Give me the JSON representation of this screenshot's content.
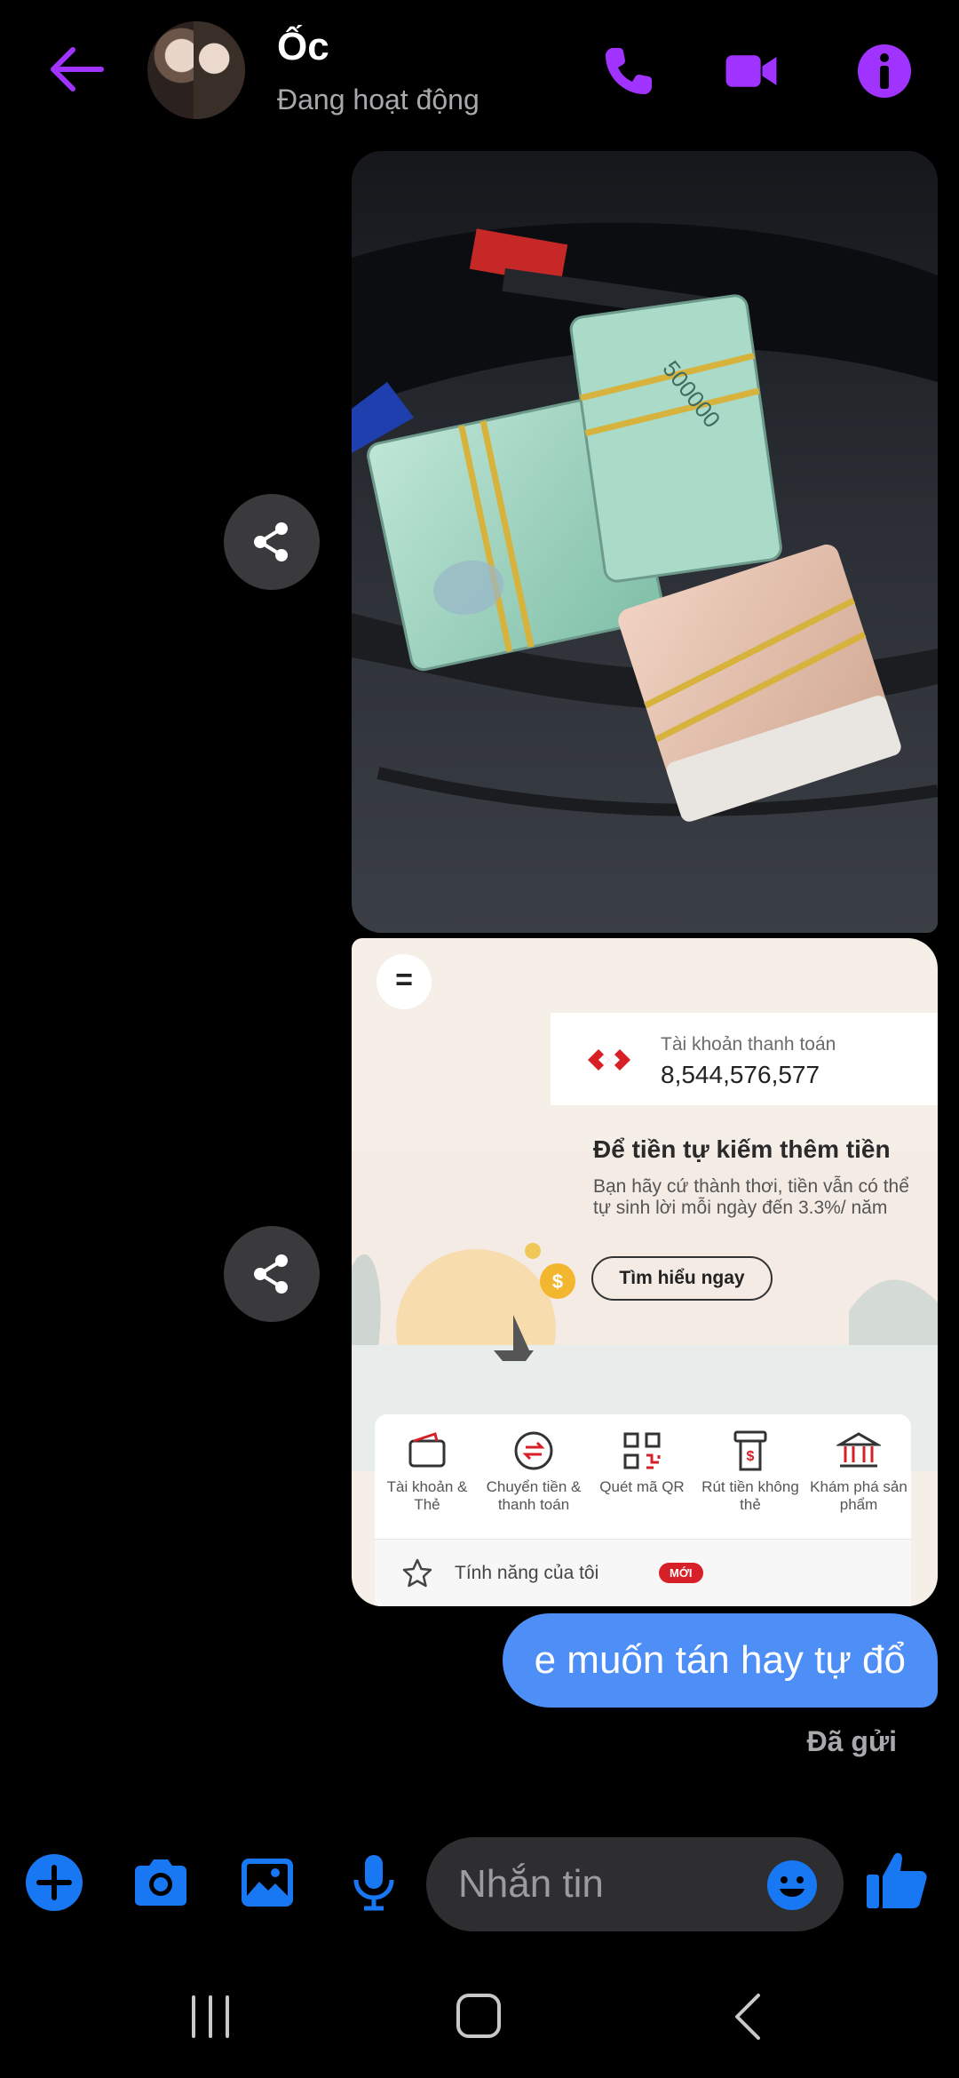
{
  "header": {
    "contact_name": "Ốc",
    "contact_status": "Đang hoạt động",
    "icons": [
      "back-arrow-icon",
      "phone-icon",
      "video-camera-icon",
      "info-icon"
    ],
    "accent_color": "#a033ff"
  },
  "messages": {
    "banking_screenshot": {
      "account_label": "Tài khoản thanh toán",
      "account_number": "8,544,576,577",
      "promo_title": "Để tiền tự kiếm thêm tiền",
      "promo_text": "Bạn hãy cứ thành thơi, tiền vẫn có thể tự sinh lời mỗi ngày đến 3.3%/ năm",
      "promo_button": "Tìm hiểu ngay",
      "shortcuts": [
        {
          "label": "Tài khoản & Thẻ",
          "icon": "wallet-icon"
        },
        {
          "label": "Chuyển tiền & thanh toán",
          "icon": "transfer-icon"
        },
        {
          "label": "Quét mã QR",
          "icon": "qr-code-icon"
        },
        {
          "label": "Rút tiền không thẻ",
          "icon": "atm-icon"
        },
        {
          "label": "Khám phá sản phẩm",
          "icon": "bank-icon"
        }
      ],
      "features_label": "Tính năng của tôi",
      "features_badge": "MỚI",
      "brand_color": "#d61f26"
    },
    "text_message": "e muốn tán hay tự đổ",
    "sent_status": "Đã gửi",
    "bubble_color": "#4e8ef7"
  },
  "composer": {
    "placeholder": "Nhắn tin",
    "icons": [
      "plus-icon",
      "camera-icon",
      "gallery-icon",
      "microphone-icon",
      "emoji-icon",
      "thumbs-up-icon"
    ],
    "icon_color": "#1877f2"
  },
  "navbar": {
    "icons": [
      "recents-icon",
      "home-icon",
      "back-icon"
    ]
  }
}
